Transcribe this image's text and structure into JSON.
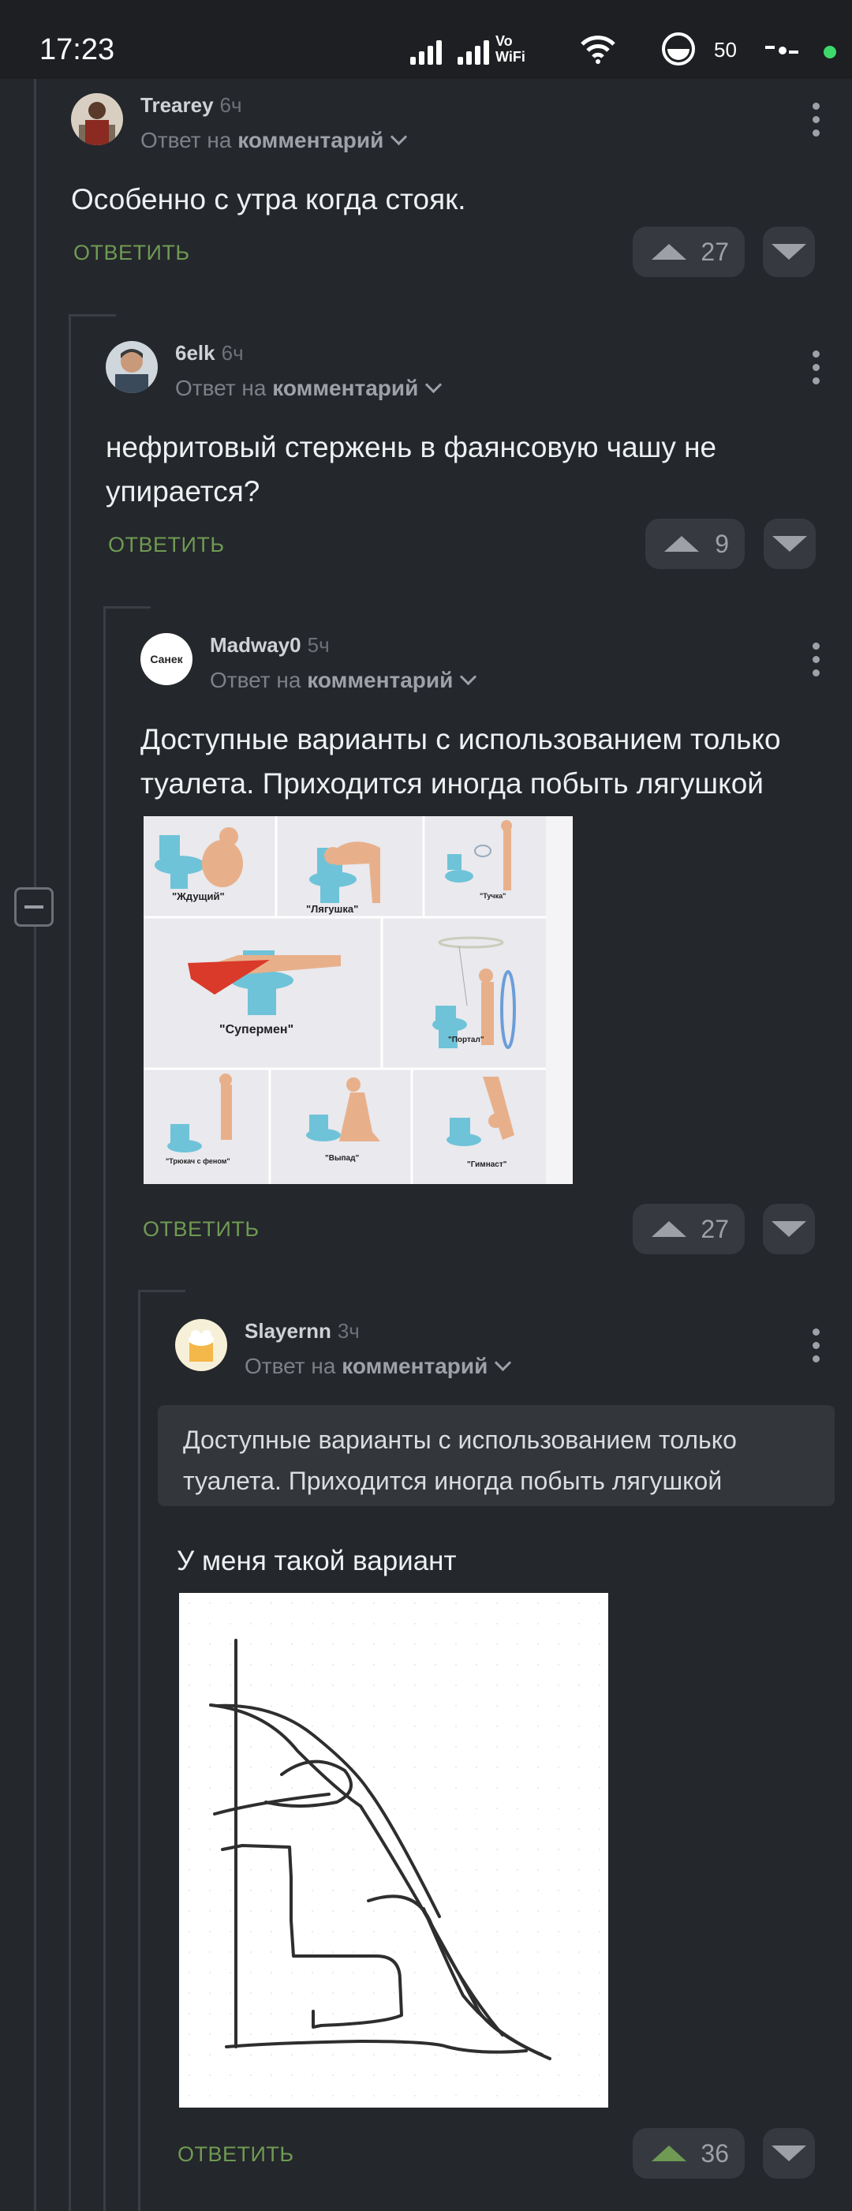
{
  "status": {
    "time": "17:23",
    "network": "Vo WiFi",
    "battery": "50"
  },
  "comments": [
    {
      "author": "Trearey",
      "age": "6ч",
      "reply_prefix": "Ответ на",
      "reply_target": "комментарий",
      "text": "Особенно с утра когда стояк.",
      "reply": "ОТВЕТИТЬ",
      "votes": "27"
    },
    {
      "author": "6elk",
      "age": "6ч",
      "reply_prefix": "Ответ на",
      "reply_target": "комментарий",
      "text": "нефритовый стержень в фаянсовую чашу не упирается?",
      "reply": "ОТВЕТИТЬ",
      "votes": "9"
    },
    {
      "author": "Madway0",
      "age": "5ч",
      "avatar_text": "Санек",
      "reply_prefix": "Ответ на",
      "reply_target": "комментарий",
      "text": "Доступные варианты с использованием только туалета. Приходится иногда побыть лягушкой",
      "reply": "ОТВЕТИТЬ",
      "votes": "27",
      "image_labels": [
        "\"Ждущий\"",
        "\"Лягушка\"",
        "\"Тучка\"",
        "\"Супермен\"",
        "\"Портал\"",
        "\"Трюкач с феном\"",
        "\"Выпад\"",
        "\"Гимнаст\""
      ]
    },
    {
      "author": "Slayernn",
      "age": "3ч",
      "reply_prefix": "Ответ на",
      "reply_target": "комментарий",
      "quote": "Доступные варианты с использованием только туалета. Приходится иногда побыть лягушкой",
      "text": "У меня такой вариант",
      "reply": "ОТВЕТИТЬ",
      "votes": "36"
    }
  ]
}
